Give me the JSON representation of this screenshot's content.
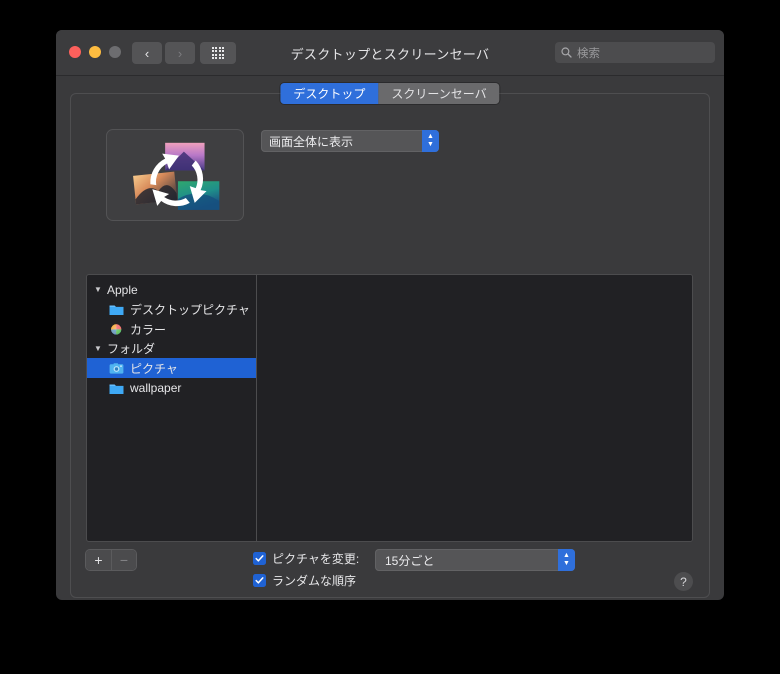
{
  "window": {
    "title": "デスクトップとスクリーンセーバ",
    "traffic_lights": [
      {
        "name": "close",
        "color": "#fc605c"
      },
      {
        "name": "minimize",
        "color": "#fdbc40"
      },
      {
        "name": "zoom",
        "color": "#6d6d70"
      }
    ],
    "nav": {
      "back_glyph": "‹",
      "forward_glyph": "›",
      "show_all_name": "show-all-grid"
    },
    "accent_color": "#2f6fdb",
    "background_color": "#3a3a3c",
    "list_background_color": "#212124"
  },
  "search": {
    "placeholder": "検索",
    "value": "",
    "icon": "search-icon"
  },
  "tabs": [
    {
      "label": "デスクトップ",
      "active": true
    },
    {
      "label": "スクリーンセーバ",
      "active": false
    }
  ],
  "preview": {
    "name": "desktop-preview-thumbnail",
    "description": "rotating-pictures-icon"
  },
  "fit_popup": {
    "value": "画面全体に表示",
    "up_glyph": "▲",
    "down_glyph": "▼"
  },
  "source_list": {
    "groups": [
      {
        "label": "Apple",
        "disclosure": "▼",
        "items": [
          {
            "label": "デスクトップピクチャ",
            "icon": "blue-folder-icon",
            "selected": false
          },
          {
            "label": "カラー",
            "icon": "color-wheel-icon",
            "selected": false
          }
        ]
      },
      {
        "label": "フォルダ",
        "disclosure": "▼",
        "items": [
          {
            "label": "ピクチャ",
            "icon": "photos-folder-icon",
            "selected": true
          },
          {
            "label": "wallpaper",
            "icon": "blue-folder-icon",
            "selected": false
          }
        ]
      }
    ]
  },
  "add_remove": {
    "add_label": "+",
    "remove_label": "−"
  },
  "options": {
    "change_picture": {
      "label": "ピクチャを変更:",
      "checked": true,
      "check_glyph": "✓"
    },
    "random_order": {
      "label": "ランダムな順序",
      "checked": true,
      "check_glyph": "✓"
    },
    "interval": {
      "value": "15分ごと"
    }
  },
  "help": {
    "label": "?"
  }
}
